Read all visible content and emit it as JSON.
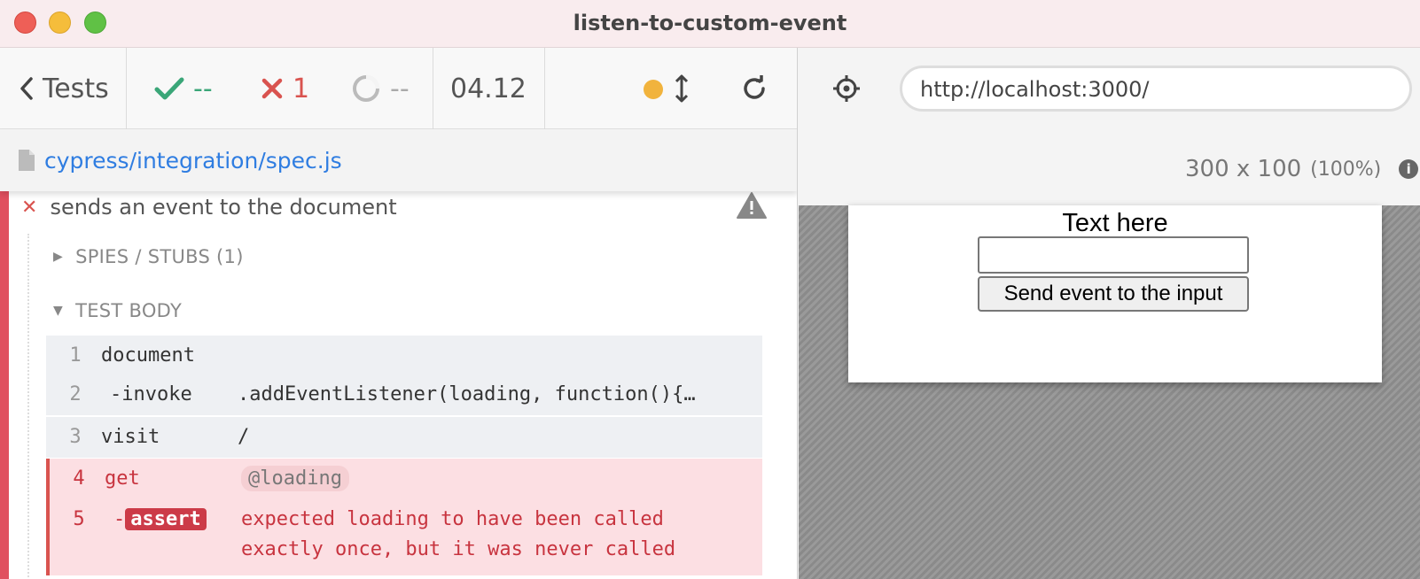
{
  "window": {
    "title": "listen-to-custom-event"
  },
  "stats": {
    "tests_label": "Tests",
    "passed": "--",
    "failed": "1",
    "pending": "--",
    "duration": "04.12"
  },
  "spec": {
    "path": "cypress/integration/spec.js"
  },
  "test": {
    "title": "sends an event to the document",
    "spies_label": "SPIES / STUBS (1)",
    "body_label": "TEST BODY",
    "commands": [
      {
        "num": "1",
        "name": "document",
        "message": ""
      },
      {
        "num": "2",
        "name": "-invoke",
        "message": ".addEventListener(loading, function(){…"
      },
      {
        "num": "3",
        "name": "visit",
        "message": "/"
      },
      {
        "num": "4",
        "name": "get",
        "message": "@loading"
      },
      {
        "num": "5",
        "prefix": "-",
        "name": "assert",
        "message_line1": "expected loading to have been called",
        "message_line2": "exactly once, but it was never called"
      }
    ]
  },
  "app": {
    "url": "http://localhost:3000/",
    "viewport": "300 x 100",
    "scale": "(100%)",
    "info_icon_text": "i",
    "page_text": "Text here",
    "input_value": "",
    "button_label": "Send event to the input"
  },
  "colors": {
    "fail": "#d9534f",
    "pass": "#3aa678",
    "link": "#2f7de1",
    "running_dot": "#f1b33d"
  }
}
